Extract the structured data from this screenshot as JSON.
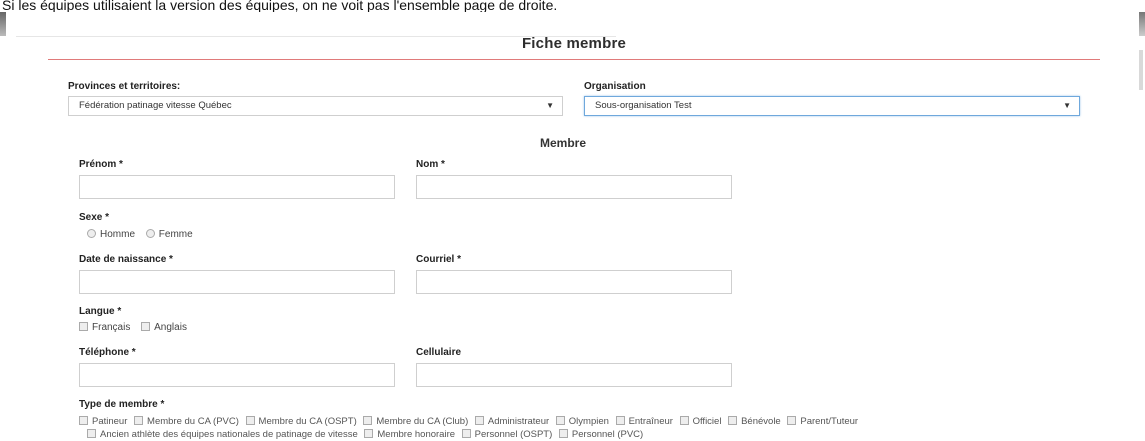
{
  "browser_overlay": {
    "clipped_text": "Si les équipes utilisaient la version des équipes, on ne voit pas l'ensemble page de droite."
  },
  "page_title": "Fiche membre",
  "organisation_row": {
    "province": {
      "label": "Provinces et territoires:",
      "value": "Fédération patinage vitesse Québec"
    },
    "organisation": {
      "label": "Organisation",
      "value": "Sous-organisation Test"
    }
  },
  "section_title": "Membre",
  "fields": {
    "prenom": {
      "label": "Prénom *",
      "value": ""
    },
    "nom": {
      "label": "Nom *",
      "value": ""
    },
    "sexe": {
      "label": "Sexe *",
      "options": [
        "Homme",
        "Femme"
      ]
    },
    "date_naissance": {
      "label": "Date de naissance *",
      "value": ""
    },
    "courriel": {
      "label": "Courriel *",
      "value": ""
    },
    "langue": {
      "label": "Langue *",
      "options": [
        "Français",
        "Anglais"
      ]
    },
    "telephone": {
      "label": "Téléphone *",
      "value": ""
    },
    "cellulaire": {
      "label": "Cellulaire",
      "value": ""
    },
    "type_membre": {
      "label": "Type de membre *",
      "options_row1": [
        "Patineur",
        "Membre du CA (PVC)",
        "Membre du CA (OSPT)",
        "Membre du CA (Club)",
        "Administrateur",
        "Olympien",
        "Entraîneur",
        "Officiel",
        "Bénévole",
        "Parent/Tuteur"
      ],
      "options_row2": [
        "Ancien athlète des équipes nationales de patinage de vitesse",
        "Membre honoraire",
        "Personnel (OSPT)",
        "Personnel (PVC)"
      ]
    }
  },
  "icons": {
    "select_arrow": "▼"
  }
}
